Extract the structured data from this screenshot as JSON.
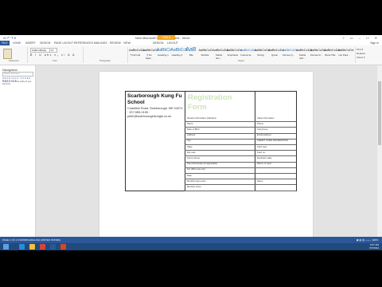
{
  "window": {
    "title": "New Microsoft Word Document - Word",
    "contextual_tab": "TABLE TOOLS",
    "quick_access": "W ↶ ↷ ▾",
    "window_buttons": "? ▭ – ☐ ✕"
  },
  "tabs": [
    "FILE",
    "HOME",
    "INSERT",
    "DESIGN",
    "PAGE LAYOUT",
    "REFERENCES",
    "MAILINGS",
    "REVIEW",
    "VIEW",
    "DESIGN",
    "LAYOUT"
  ],
  "signin": "Sign in",
  "ribbon": {
    "groups": [
      "Clipboard",
      "Font",
      "Paragraph",
      "Styles",
      "Editing"
    ],
    "font_name": "Calibri (Body)",
    "font_size": "11",
    "format_row": "B I U abc x₂ x² A A",
    "styles": [
      {
        "preview": "AaBbCcDc",
        "label": "¶ Normal",
        "kind": "normal"
      },
      {
        "preview": "AaBbCcDc",
        "label": "¶ No Spac...",
        "kind": "normal"
      },
      {
        "preview": "AaBbCc",
        "label": "Heading 1",
        "kind": "mid"
      },
      {
        "preview": "AaBbCcE",
        "label": "Heading 2",
        "kind": "mid"
      },
      {
        "preview": "AaB",
        "label": "Title",
        "kind": "big"
      },
      {
        "preview": "AaBbCcD",
        "label": "Subtitle",
        "kind": "normal"
      },
      {
        "preview": "AaBbCcDd",
        "label": "Subtle Em...",
        "kind": "normal"
      },
      {
        "preview": "AaBbCcDd",
        "label": "Emphasis",
        "kind": "normal"
      },
      {
        "preview": "AaBbCcDd",
        "label": "Intense E...",
        "kind": "under"
      },
      {
        "preview": "AaBbCcDd",
        "label": "Strong",
        "kind": "normal"
      },
      {
        "preview": "AaBbCcDd",
        "label": "Quote",
        "kind": "normal"
      },
      {
        "preview": "AaBbCcDd",
        "label": "Intense Q...",
        "kind": "under"
      },
      {
        "preview": "AaBbCcDd",
        "label": "Subtle Ref...",
        "kind": "normal"
      },
      {
        "preview": "AaBbCcDd",
        "label": "Intense R...",
        "kind": "normal"
      },
      {
        "preview": "AaBbCcDd",
        "label": "Book Title",
        "kind": "normal"
      },
      {
        "preview": "AaBbCcDd",
        "label": "List Para...",
        "kind": "normal"
      }
    ],
    "editing": [
      "Find ▾",
      "Replace",
      "Select ▾"
    ]
  },
  "nav": {
    "title": "Navigation",
    "search_placeholder": "Search document",
    "tabs": "HEADINGS PAGES RESULTS",
    "text": "Create an interactive outline of your document."
  },
  "document": {
    "school_name": "Scarborough Kung Fu School",
    "address": "Coastline Road, Scarborough, ME 04074 · 207-555-0155 · peter@scarboroughkungfu.co.uk",
    "form_title": "Registration Form",
    "rows_left": [
      "Student information (Student)",
      "Name",
      "Date of Birth",
      "Address",
      "City",
      "State",
      "Zip code",
      "Home phone",
      "Parent/Guardian (If applicable)",
      "For office use only",
      "Date",
      "Monthly dues price",
      "Member since"
    ],
    "rows_right": [
      "Class information",
      "Phone",
      "Cell phone",
      "Email address",
      "CREDIT CARD INFORMATION",
      "Card type",
      "Card no.",
      "Expiration date",
      "Name on card",
      "",
      "",
      "Name",
      "",
      ""
    ]
  },
  "status": {
    "left": "PAGE 1 OF 1   0 WORDS   ENGLISH (UNITED STATES)",
    "right": "▣ ▤ ▥  —+—  100%"
  },
  "taskbar": {
    "icons": [
      {
        "name": "ie-icon",
        "color": "#2d8ad8"
      },
      {
        "name": "explorer-icon",
        "color": "#f0c040"
      },
      {
        "name": "chrome-icon",
        "color": "#d44638"
      },
      {
        "name": "word-icon",
        "color": "#2b579a"
      },
      {
        "name": "powerpoint-icon",
        "color": "#d24726"
      }
    ],
    "clock": "9:07 AM",
    "date": "5/7/2014"
  }
}
